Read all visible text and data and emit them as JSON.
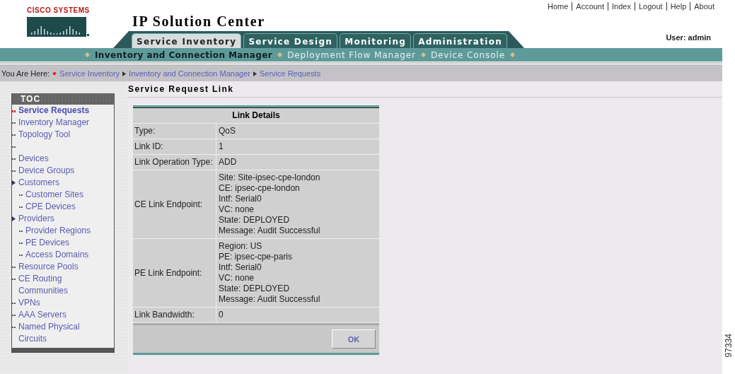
{
  "logo": {
    "text": "CISCO SYSTEMS"
  },
  "title": "IP Solution Center",
  "top_links": [
    "Home",
    "Account",
    "Index",
    "Logout",
    "Help",
    "About"
  ],
  "tabs": [
    {
      "label": "Service Inventory",
      "selected": true
    },
    {
      "label": "Service Design",
      "selected": false
    },
    {
      "label": "Monitoring",
      "selected": false
    },
    {
      "label": "Administration",
      "selected": false
    }
  ],
  "user": "User: admin",
  "subnav": [
    {
      "label": "Inventory and Connection Manager",
      "selected": true
    },
    {
      "label": "Deployment Flow Manager",
      "selected": false
    },
    {
      "label": "Device Console",
      "selected": false
    }
  ],
  "breadcrumb": {
    "label": "You Are Here:",
    "items": [
      "Service Inventory",
      "Inventory and Connection Manager",
      "Service Requests"
    ]
  },
  "toc": {
    "title": "TOC",
    "items": [
      {
        "kind": "link",
        "label": "Service Requests",
        "selected": true
      },
      {
        "kind": "link",
        "label": "Inventory Manager",
        "selected": false
      },
      {
        "kind": "link",
        "label": "Topology Tool",
        "selected": false
      },
      {
        "kind": "blank",
        "selected": false
      },
      {
        "kind": "link",
        "label": "Devices",
        "selected": false
      },
      {
        "kind": "link",
        "label": "Device Groups",
        "selected": false
      },
      {
        "kind": "group",
        "label": "Customers",
        "selected": false,
        "children": [
          {
            "label": "Customer Sites",
            "selected": false
          },
          {
            "label": "CPE Devices",
            "selected": false
          }
        ]
      },
      {
        "kind": "group",
        "label": "Providers",
        "selected": false,
        "children": [
          {
            "label": "Provider Regions",
            "selected": false
          },
          {
            "label": "PE Devices",
            "selected": false
          },
          {
            "label": "Access Domains",
            "selected": false
          }
        ]
      },
      {
        "kind": "link",
        "label": "Resource Pools",
        "selected": false
      },
      {
        "kind": "link",
        "label": "CE Routing Communities",
        "selected": false
      },
      {
        "kind": "link",
        "label": "VPNs",
        "selected": false
      },
      {
        "kind": "link",
        "label": "AAA Servers",
        "selected": false
      },
      {
        "kind": "link",
        "label": "Named Physical Circuits",
        "selected": false
      }
    ]
  },
  "page_title": "Service Request Link",
  "table": {
    "title": "Link Details",
    "rows": [
      {
        "label": "Type:",
        "value": [
          "QoS"
        ]
      },
      {
        "label": "Link ID:",
        "value": [
          "1"
        ]
      },
      {
        "label": "Link Operation Type:",
        "value": [
          "ADD"
        ]
      },
      {
        "label": "CE Link Endpoint:",
        "value": [
          "Site: Site-ipsec-cpe-london",
          "CE: ipsec-cpe-london",
          "Intf: Serial0",
          "VC: none",
          "State: DEPLOYED",
          "Message: Audit Successful"
        ]
      },
      {
        "label": "PE Link Endpoint:",
        "value": [
          "Region: US",
          "PE: ipsec-cpe-paris",
          "Intf: Serial0",
          "VC: none",
          "State: DEPLOYED",
          "Message: Audit Successful"
        ]
      },
      {
        "label": "Link Bandwidth:",
        "value": [
          "0"
        ]
      }
    ],
    "button": "OK"
  },
  "figure_number": "97334"
}
